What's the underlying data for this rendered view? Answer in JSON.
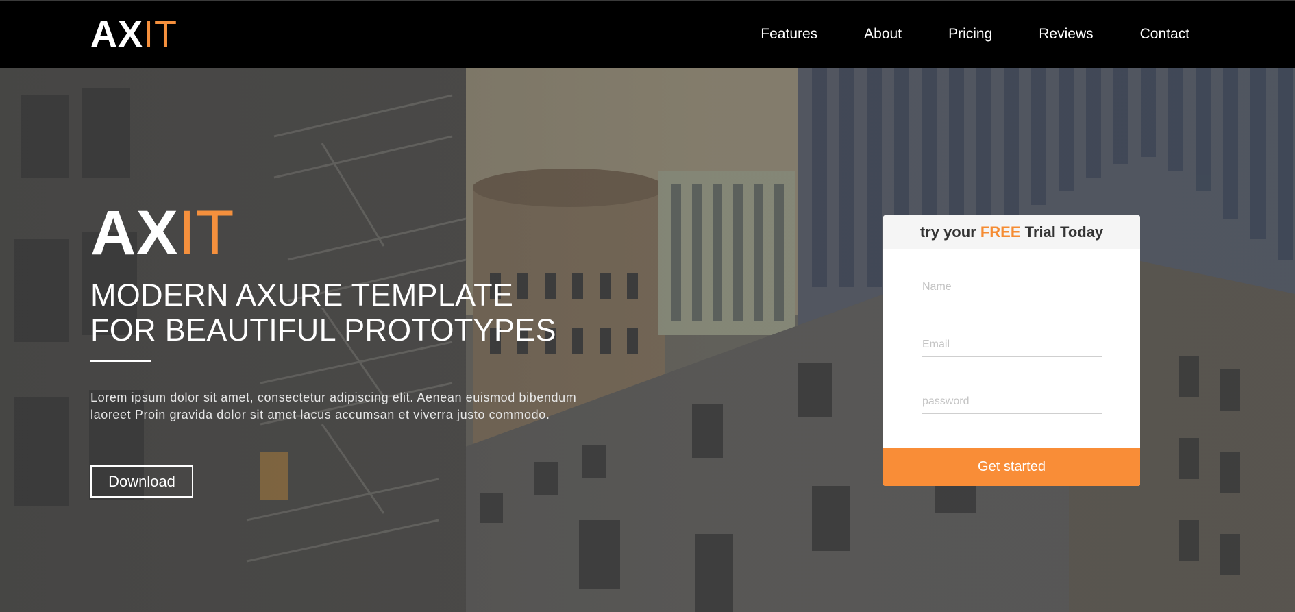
{
  "header": {
    "logo": {
      "ax": "AX",
      "it": "IT"
    },
    "nav": [
      {
        "label": "Features"
      },
      {
        "label": "About"
      },
      {
        "label": "Pricing"
      },
      {
        "label": "Reviews"
      },
      {
        "label": "Contact"
      }
    ]
  },
  "hero": {
    "logo": {
      "ax": "AX",
      "it": "IT"
    },
    "headline_line1": "MODERN AXURE TEMPLATE",
    "headline_line2": "FOR BEAUTIFUL PROTOTYPES",
    "description": "Lorem ipsum dolor sit amet, consectetur adipiscing elit. Aenean euismod bibendum laoreet Proin gravida dolor sit amet lacus accumsan et viverra justo commodo.",
    "download_label": "Download"
  },
  "signup": {
    "title_prefix": "try your ",
    "title_highlight": "FREE",
    "title_suffix": " Trial Today",
    "name_placeholder": "Name",
    "email_placeholder": "Email",
    "password_placeholder": "password",
    "submit_label": "Get started"
  },
  "colors": {
    "accent": "#f98d37",
    "header_bg": "#000000"
  }
}
